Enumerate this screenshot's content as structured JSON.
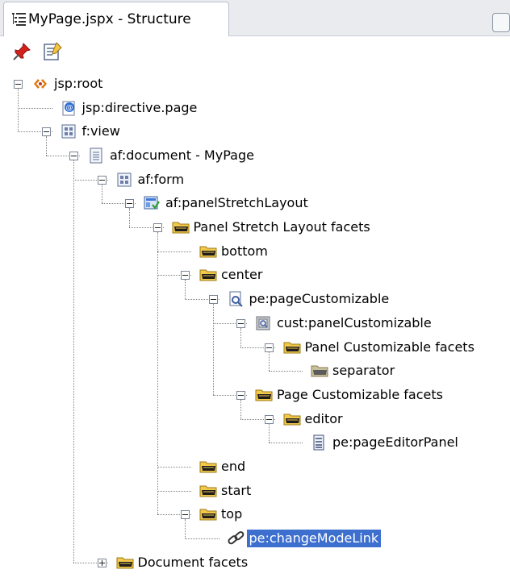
{
  "window": {
    "title": "MyPage.jspx - Structure"
  },
  "toolbar": {
    "buttons": [
      {
        "name": "pin-icon",
        "tooltip": ""
      },
      {
        "name": "edit-properties-icon",
        "tooltip": ""
      }
    ]
  },
  "tree": [
    {
      "id": "n0",
      "label": "jsp:root",
      "icon": "jsp-root-icon",
      "depth": 0,
      "expander": "minus"
    },
    {
      "id": "n1",
      "label": "jsp:directive.page",
      "icon": "directive-icon",
      "depth": 1,
      "expander": "none"
    },
    {
      "id": "n2",
      "label": "f:view",
      "icon": "grid-component-icon",
      "depth": 1,
      "expander": "minus"
    },
    {
      "id": "n3",
      "label": "af:document - MyPage",
      "icon": "document-icon",
      "depth": 2,
      "expander": "minus"
    },
    {
      "id": "n4",
      "label": "af:form",
      "icon": "grid-component-icon",
      "depth": 3,
      "expander": "minus"
    },
    {
      "id": "n5",
      "label": "af:panelStretchLayout",
      "icon": "panel-layout-icon",
      "depth": 4,
      "expander": "minus"
    },
    {
      "id": "n6",
      "label": "Panel Stretch Layout facets",
      "icon": "facet-folder-icon",
      "depth": 5,
      "expander": "minus"
    },
    {
      "id": "n7",
      "label": "bottom",
      "icon": "facet-folder-icon",
      "depth": 6,
      "expander": "none"
    },
    {
      "id": "n8",
      "label": "center",
      "icon": "facet-folder-icon",
      "depth": 6,
      "expander": "minus"
    },
    {
      "id": "n9",
      "label": "pe:pageCustomizable",
      "icon": "page-customizable-icon",
      "depth": 7,
      "expander": "minus"
    },
    {
      "id": "n10",
      "label": "cust:panelCustomizable",
      "icon": "panel-customizable-icon",
      "depth": 8,
      "expander": "minus"
    },
    {
      "id": "n11",
      "label": "Panel Customizable facets",
      "icon": "facet-folder-icon",
      "depth": 9,
      "expander": "minus"
    },
    {
      "id": "n12",
      "label": "separator",
      "icon": "facet-folder-empty-icon",
      "depth": 10,
      "expander": "none"
    },
    {
      "id": "n13",
      "label": "Page Customizable facets",
      "icon": "facet-folder-icon",
      "depth": 8,
      "expander": "minus"
    },
    {
      "id": "n14",
      "label": "editor",
      "icon": "facet-folder-icon",
      "depth": 9,
      "expander": "minus"
    },
    {
      "id": "n15",
      "label": "pe:pageEditorPanel",
      "icon": "editor-panel-icon",
      "depth": 10,
      "expander": "none"
    },
    {
      "id": "n16",
      "label": "end",
      "icon": "facet-folder-icon",
      "depth": 6,
      "expander": "none"
    },
    {
      "id": "n17",
      "label": "start",
      "icon": "facet-folder-icon",
      "depth": 6,
      "expander": "none"
    },
    {
      "id": "n18",
      "label": "top",
      "icon": "facet-folder-icon",
      "depth": 6,
      "expander": "minus"
    },
    {
      "id": "n19",
      "label": "pe:changeModeLink",
      "icon": "link-icon",
      "depth": 7,
      "expander": "none",
      "selected": true
    },
    {
      "id": "n20",
      "label": "Document facets",
      "icon": "facet-folder-icon",
      "depth": 3,
      "expander": "plus"
    }
  ],
  "colors": {
    "selection": "#3d6fcf",
    "folder_yellow": "#f2c94c",
    "tree_lines": "#808080"
  }
}
